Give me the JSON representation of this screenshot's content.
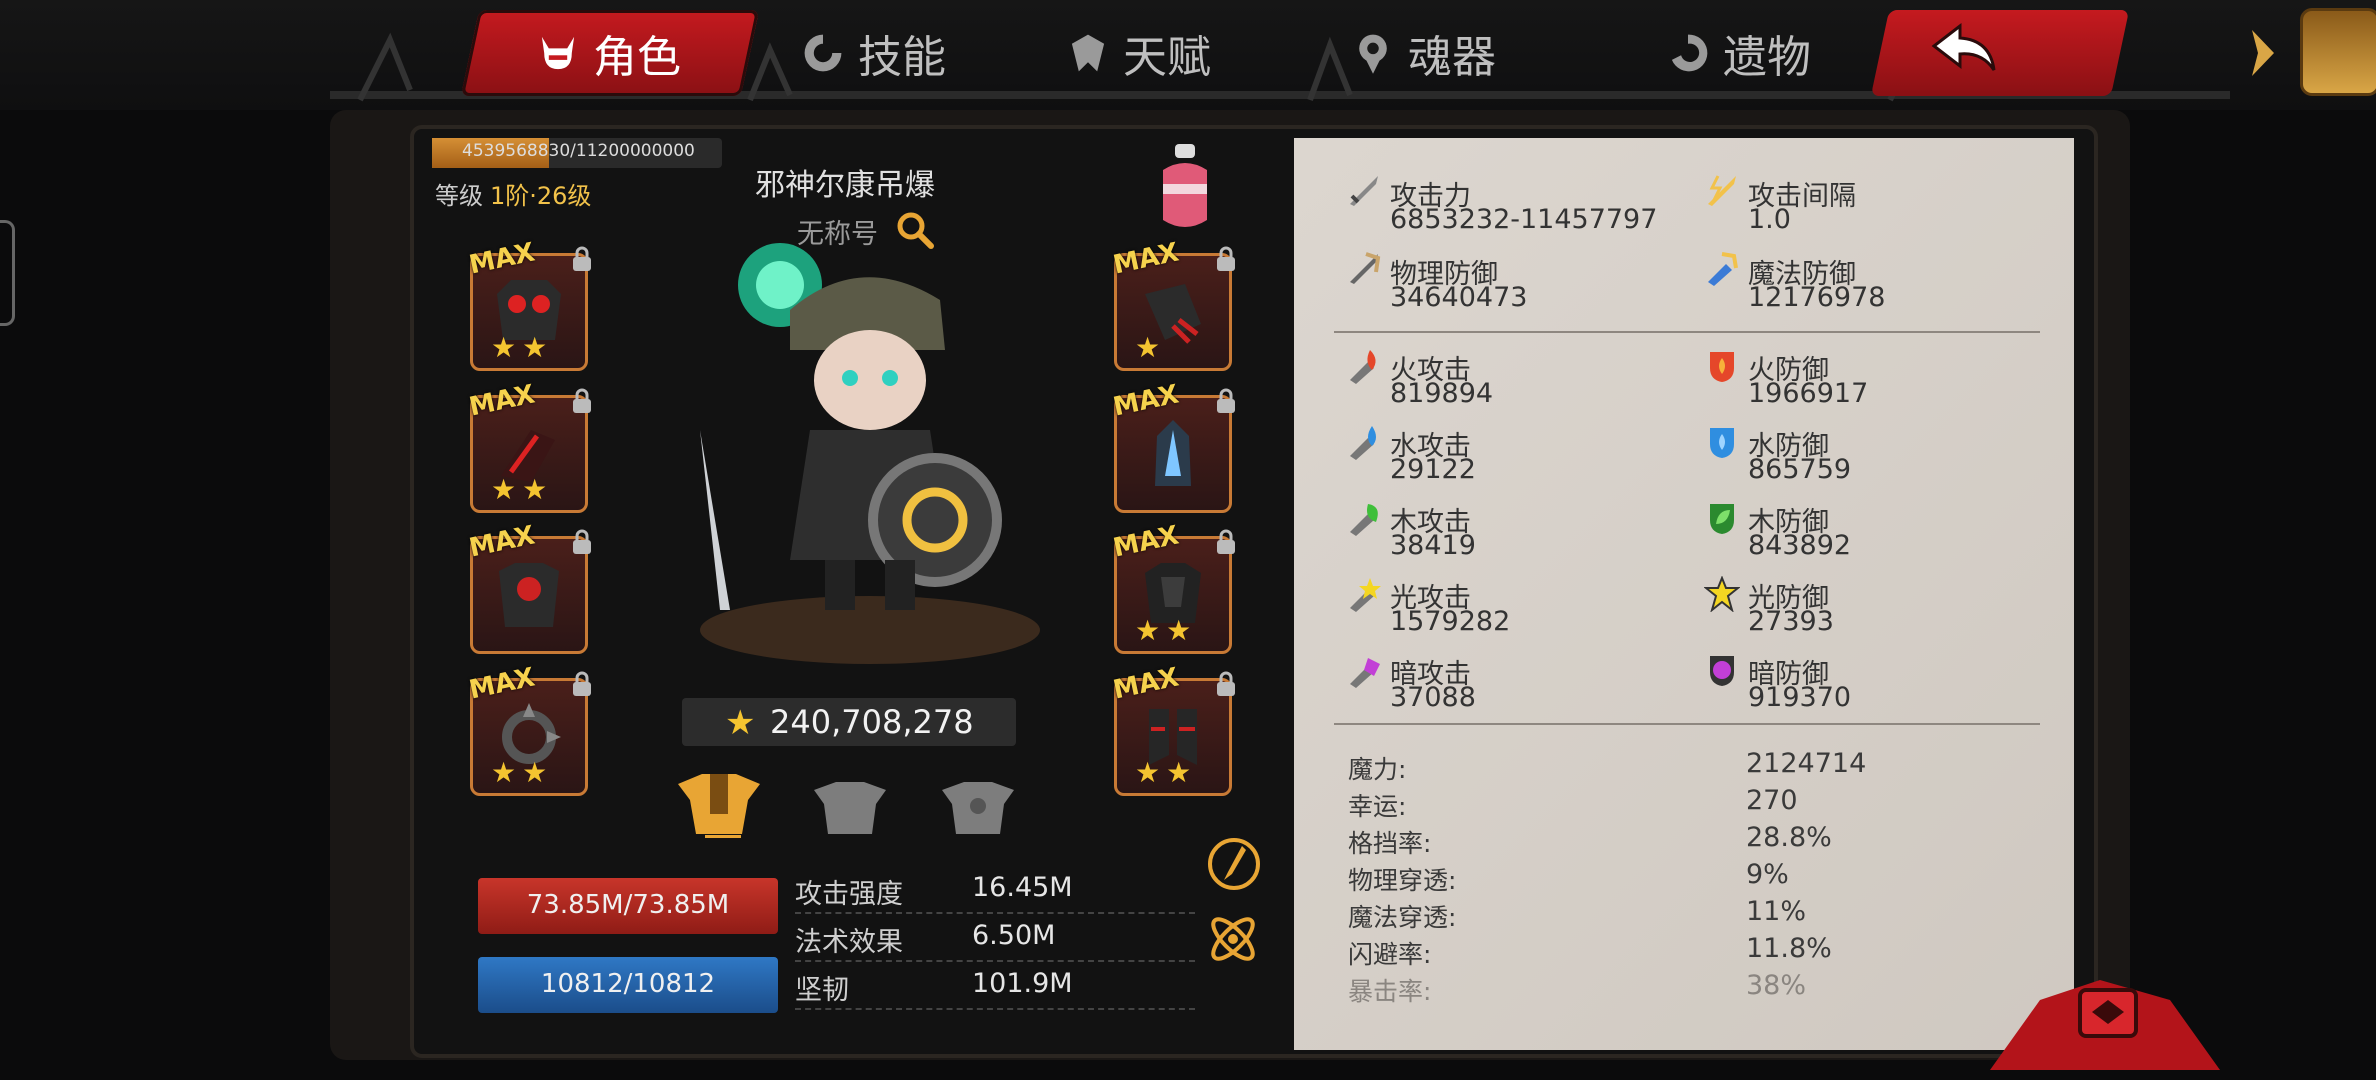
{
  "tabs": [
    {
      "label": "角色",
      "icon": "horned-helmet-icon",
      "active": true
    },
    {
      "label": "技能",
      "icon": "skill-swirl-icon",
      "active": false
    },
    {
      "label": "天赋",
      "icon": "talent-crest-icon",
      "active": false
    },
    {
      "label": "魂器",
      "icon": "soul-vessel-icon",
      "active": false
    },
    {
      "label": "遗物",
      "icon": "relic-swirl-icon",
      "active": false
    }
  ],
  "character": {
    "exp_text": "4539568830/11200000000",
    "exp_fraction": 0.405,
    "level_label": "等级",
    "level_value": "1阶·26级",
    "name": "邪神尔康吊爆",
    "title": "无称号",
    "power": "240,708,278"
  },
  "equipment": {
    "max_label": "MAX",
    "left": [
      {
        "name": "demon-helmet",
        "stars": "★★"
      },
      {
        "name": "red-gauntlet",
        "stars": "★★"
      },
      {
        "name": "dark-armor",
        "stars": ""
      },
      {
        "name": "spiked-ring",
        "stars": "★★"
      }
    ],
    "right": [
      {
        "name": "claw-glove",
        "stars": "★"
      },
      {
        "name": "crystal-amulet",
        "stars": ""
      },
      {
        "name": "black-armor",
        "stars": "★★"
      },
      {
        "name": "spiked-boots",
        "stars": "★★"
      }
    ]
  },
  "vitals": {
    "hp": "73.85M/73.85M",
    "mp": "10812/10812"
  },
  "basic_stats": [
    {
      "label": "攻击强度",
      "value": "16.45M"
    },
    {
      "label": "法术效果",
      "value": "6.50M"
    },
    {
      "label": "坚韧",
      "value": "101.9M"
    }
  ],
  "stats": {
    "main": [
      {
        "label": "攻击力",
        "value": "6853232-11457797",
        "icon": "sword-icon"
      },
      {
        "label": "攻击间隔",
        "value": "1.0",
        "icon": "lightning-sword-icon"
      },
      {
        "label": "物理防御",
        "value": "34640473",
        "icon": "physical-defense-icon"
      },
      {
        "label": "魔法防御",
        "value": "12176978",
        "icon": "magic-defense-icon"
      }
    ],
    "elements": [
      {
        "atk_label": "火攻击",
        "atk_value": "819894",
        "def_label": "火防御",
        "def_value": "1966917",
        "color": "#e5472a"
      },
      {
        "atk_label": "水攻击",
        "atk_value": "29122",
        "def_label": "水防御",
        "def_value": "865759",
        "color": "#2f8ee0"
      },
      {
        "atk_label": "木攻击",
        "atk_value": "38419",
        "def_label": "木防御",
        "def_value": "843892",
        "color": "#3fbf3a"
      },
      {
        "atk_label": "光攻击",
        "atk_value": "1579282",
        "def_label": "光防御",
        "def_value": "27393",
        "color": "#f4d622"
      },
      {
        "atk_label": "暗攻击",
        "atk_value": "37088",
        "def_label": "暗防御",
        "def_value": "919370",
        "color": "#c23fd6"
      }
    ],
    "props": [
      {
        "label": "魔力:",
        "value": "2124714"
      },
      {
        "label": "幸运:",
        "value": "270"
      },
      {
        "label": "格挡率:",
        "value": "28.8%"
      },
      {
        "label": "物理穿透:",
        "value": "9%"
      },
      {
        "label": "魔法穿透:",
        "value": "11%"
      },
      {
        "label": "闪避率:",
        "value": "11.8%"
      },
      {
        "label": "暴击率:",
        "value": "38%"
      }
    ]
  },
  "colors": {
    "accent_red": "#c51a1f",
    "gold": "#f2c24a",
    "hp_red": "#c8352a",
    "mp_blue": "#2f78c5",
    "panel_bg": "#d6cfc7"
  }
}
